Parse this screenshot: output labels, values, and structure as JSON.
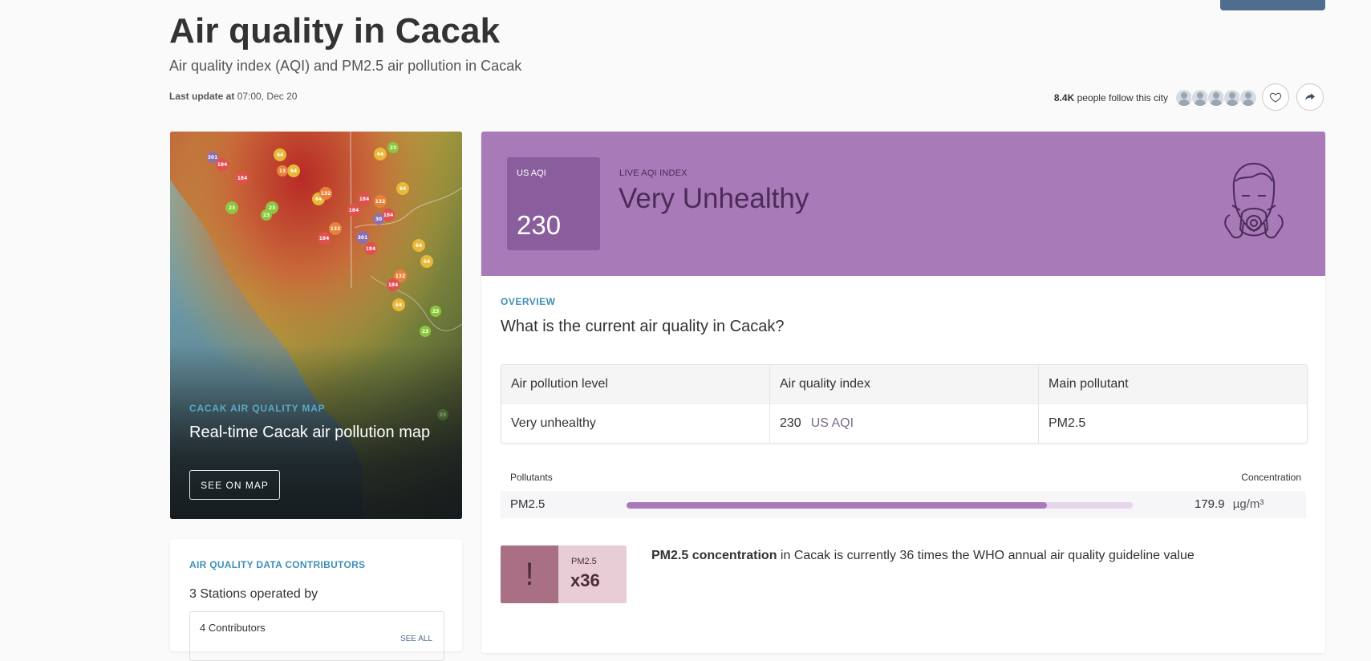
{
  "header": {
    "title": "Air quality in Cacak",
    "subtitle": "Air quality index (AQI) and PM2.5 air pollution in Cacak",
    "last_update_label": "Last update at",
    "last_update_value": "07:00, Dec 20",
    "followers_count": "8.4K",
    "followers_text": "people follow this city"
  },
  "map_card": {
    "label": "CACAK AIR QUALITY MAP",
    "title": "Real-time Cacak air pollution map",
    "button": "SEE ON MAP",
    "markers": [
      "301",
      "184",
      "184",
      "64",
      "64",
      "13",
      "23",
      "23",
      "23",
      "64",
      "132",
      "184",
      "184",
      "132",
      "184",
      "30",
      "301",
      "184",
      "132",
      "184",
      "64",
      "64",
      "64",
      "23",
      "23",
      "23",
      "64",
      "23"
    ]
  },
  "contributors": {
    "label": "AIR QUALITY DATA CONTRIBUTORS",
    "stations": "3 Stations operated by",
    "count": "4 Contributors",
    "see_all": "SEE ALL"
  },
  "aqi": {
    "box_label": "US AQI",
    "value": "230",
    "live_label": "LIVE AQI INDEX",
    "status": "Very Unhealthy",
    "banner_color": "#a87ab8"
  },
  "overview": {
    "label": "OVERVIEW",
    "question": "What is the current air quality in Cacak?",
    "table": {
      "headers": [
        "Air pollution level",
        "Air quality index",
        "Main pollutant"
      ],
      "row": {
        "level": "Very unhealthy",
        "aqi_value": "230",
        "aqi_unit": "US AQI",
        "pollutant": "PM2.5"
      }
    }
  },
  "pollutants": {
    "header_left": "Pollutants",
    "header_right": "Concentration",
    "items": [
      {
        "name": "PM2.5",
        "value": "179.9",
        "unit": "µg/m³",
        "level_fraction": 0.83
      }
    ]
  },
  "who": {
    "pollutant": "PM2.5",
    "multiplier": "x36",
    "text_bold": "PM2.5 concentration",
    "text_rest": " in Cacak is currently 36 times the WHO annual air quality guideline value"
  }
}
